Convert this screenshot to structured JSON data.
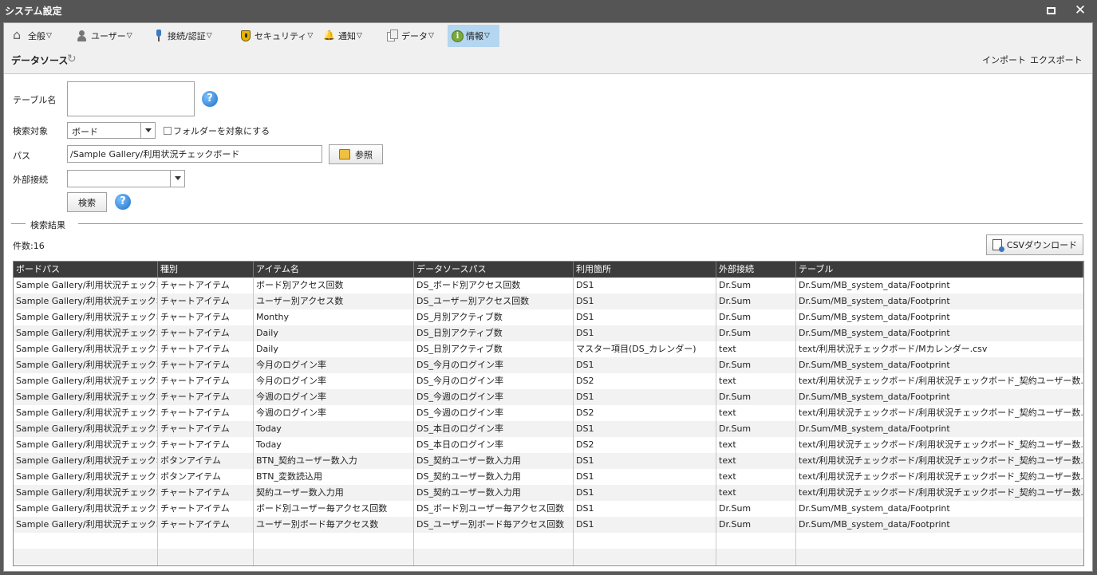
{
  "window": {
    "title": "システム設定"
  },
  "menu": [
    {
      "label": "全般",
      "icon": "home-icon"
    },
    {
      "label": "ユーザー",
      "icon": "user-icon"
    },
    {
      "label": "接続/認証",
      "icon": "plug-icon"
    },
    {
      "label": "セキュリティ",
      "icon": "shield-icon"
    },
    {
      "label": "通知",
      "icon": "bell-icon"
    },
    {
      "label": "データ",
      "icon": "data-icon"
    },
    {
      "label": "情報",
      "icon": "info-icon",
      "info_glyph": "i"
    }
  ],
  "menu_arrow": "▽",
  "section": {
    "title": "データソース"
  },
  "toolbar_links": {
    "import": "インポート",
    "export": "エクスポート"
  },
  "form": {
    "table_name_label": "テーブル名",
    "table_name_value": "",
    "search_target_label": "検索対象",
    "search_target_value": "ボード",
    "folder_checkbox_label": "フォルダーを対象にする",
    "path_label": "パス",
    "path_value": "/Sample Gallery/利用状況チェックボード",
    "browse_button": "参照",
    "external_conn_label": "外部接続",
    "external_conn_value": "",
    "search_button": "検索",
    "help_glyph": "?"
  },
  "results": {
    "legend": "検索結果",
    "count_label": "件数:16",
    "csv_button": "CSVダウンロード",
    "columns": [
      "ボードパス",
      "種別",
      "アイテム名",
      "データソースパス",
      "利用箇所",
      "外部接続",
      "テーブル"
    ],
    "rows": [
      [
        "Sample Gallery/利用状況チェックボード",
        "チャートアイテム",
        "ボード別アクセス回数",
        "DS_ボード別アクセス回数",
        "DS1",
        "Dr.Sum",
        "Dr.Sum/MB_system_data/Footprint"
      ],
      [
        "Sample Gallery/利用状況チェックボード",
        "チャートアイテム",
        "ユーザー別アクセス数",
        "DS_ユーザー別アクセス回数",
        "DS1",
        "Dr.Sum",
        "Dr.Sum/MB_system_data/Footprint"
      ],
      [
        "Sample Gallery/利用状況チェックボード",
        "チャートアイテム",
        "Monthy",
        "DS_月別アクティブ数",
        "DS1",
        "Dr.Sum",
        "Dr.Sum/MB_system_data/Footprint"
      ],
      [
        "Sample Gallery/利用状況チェックボード",
        "チャートアイテム",
        "Daily",
        "DS_日別アクティブ数",
        "DS1",
        "Dr.Sum",
        "Dr.Sum/MB_system_data/Footprint"
      ],
      [
        "Sample Gallery/利用状況チェックボード",
        "チャートアイテム",
        "Daily",
        "DS_日別アクティブ数",
        "マスター項目(DS_カレンダー)",
        "text",
        "text/利用状況チェックボード/Mカレンダー.csv"
      ],
      [
        "Sample Gallery/利用状況チェックボード",
        "チャートアイテム",
        "今月のログイン率",
        "DS_今月のログイン率",
        "DS1",
        "Dr.Sum",
        "Dr.Sum/MB_system_data/Footprint"
      ],
      [
        "Sample Gallery/利用状況チェックボード",
        "チャートアイテム",
        "今月のログイン率",
        "DS_今月のログイン率",
        "DS2",
        "text",
        "text/利用状況チェックボード/利用状況チェックボード_契約ユーザー数.csv"
      ],
      [
        "Sample Gallery/利用状況チェックボード",
        "チャートアイテム",
        "今週のログイン率",
        "DS_今週のログイン率",
        "DS1",
        "Dr.Sum",
        "Dr.Sum/MB_system_data/Footprint"
      ],
      [
        "Sample Gallery/利用状況チェックボード",
        "チャートアイテム",
        "今週のログイン率",
        "DS_今週のログイン率",
        "DS2",
        "text",
        "text/利用状況チェックボード/利用状況チェックボード_契約ユーザー数.csv"
      ],
      [
        "Sample Gallery/利用状況チェックボード",
        "チャートアイテム",
        "Today",
        "DS_本日のログイン率",
        "DS1",
        "Dr.Sum",
        "Dr.Sum/MB_system_data/Footprint"
      ],
      [
        "Sample Gallery/利用状況チェックボード",
        "チャートアイテム",
        "Today",
        "DS_本日のログイン率",
        "DS2",
        "text",
        "text/利用状況チェックボード/利用状況チェックボード_契約ユーザー数.csv"
      ],
      [
        "Sample Gallery/利用状況チェックボード",
        "ボタンアイテム",
        "BTN_契約ユーザー数入力",
        "DS_契約ユーザー数入力用",
        "DS1",
        "text",
        "text/利用状況チェックボード/利用状況チェックボード_契約ユーザー数.csv"
      ],
      [
        "Sample Gallery/利用状況チェックボード",
        "ボタンアイテム",
        "BTN_変数読込用",
        "DS_契約ユーザー数入力用",
        "DS1",
        "text",
        "text/利用状況チェックボード/利用状況チェックボード_契約ユーザー数.csv"
      ],
      [
        "Sample Gallery/利用状況チェックボード",
        "チャートアイテム",
        "契約ユーザー数入力用",
        "DS_契約ユーザー数入力用",
        "DS1",
        "text",
        "text/利用状況チェックボード/利用状況チェックボード_契約ユーザー数.csv"
      ],
      [
        "Sample Gallery/利用状況チェックボード",
        "チャートアイテム",
        "ボード別ユーザー毎アクセス回数",
        "DS_ボード別ユーザー毎アクセス回数",
        "DS1",
        "Dr.Sum",
        "Dr.Sum/MB_system_data/Footprint"
      ],
      [
        "Sample Gallery/利用状況チェックボード",
        "チャートアイテム",
        "ユーザー別ボード毎アクセス数",
        "DS_ユーザー別ボード毎アクセス回数",
        "DS1",
        "Dr.Sum",
        "Dr.Sum/MB_system_data/Footprint"
      ]
    ]
  }
}
